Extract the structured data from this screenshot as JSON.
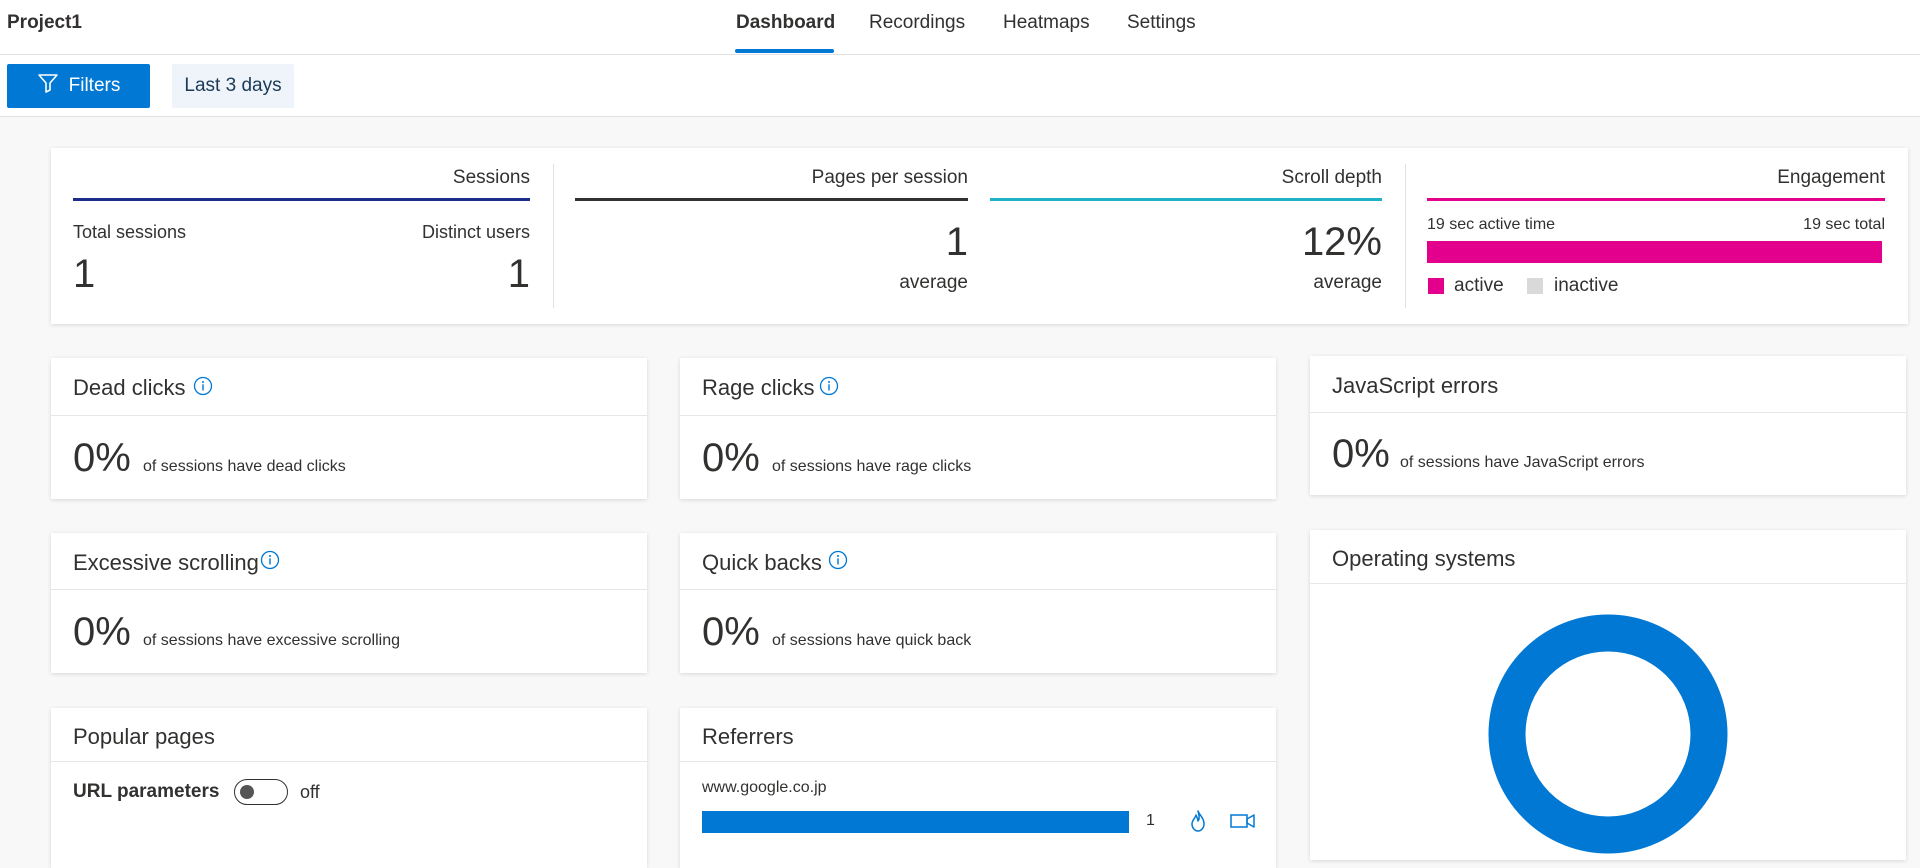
{
  "header": {
    "project": "Project1",
    "tabs": [
      "Dashboard",
      "Recordings",
      "Heatmaps",
      "Settings"
    ],
    "active_tab": "Dashboard"
  },
  "filterbar": {
    "filters_label": "Filters",
    "range_label": "Last 3 days"
  },
  "summary": {
    "sessions": {
      "title": "Sessions",
      "total_label": "Total sessions",
      "total_value": "1",
      "distinct_label": "Distinct users",
      "distinct_value": "1",
      "color": "#1b2e8a"
    },
    "pages": {
      "title": "Pages per session",
      "value": "1",
      "sub": "average",
      "color": "#323130"
    },
    "scroll": {
      "title": "Scroll depth",
      "value": "12%",
      "sub": "average",
      "color": "#1db2c5"
    },
    "engagement": {
      "title": "Engagement",
      "active_label": "19 sec active time",
      "total_label": "19 sec total",
      "active_fraction": 1.0,
      "legend_active": "active",
      "legend_inactive": "inactive",
      "color_active": "#e3008c",
      "color_inactive": "#d9d9d9"
    }
  },
  "cards": {
    "dead_clicks": {
      "title": "Dead clicks",
      "value": "0%",
      "desc": "of sessions have dead clicks"
    },
    "rage_clicks": {
      "title": "Rage clicks",
      "value": "0%",
      "desc": "of sessions have rage clicks"
    },
    "js_errors": {
      "title": "JavaScript errors",
      "value": "0%",
      "desc": "of sessions have JavaScript errors"
    },
    "excessive_scrolling": {
      "title": "Excessive scrolling",
      "value": "0%",
      "desc": "of sessions have excessive scrolling"
    },
    "quick_backs": {
      "title": "Quick backs",
      "value": "0%",
      "desc": "of sessions have quick back"
    },
    "operating_systems": {
      "title": "Operating systems",
      "donut_color": "#0078d4",
      "share": 1.0
    },
    "popular_pages": {
      "title": "Popular pages",
      "url_params_label": "URL parameters",
      "toggle_state": "off"
    },
    "referrers": {
      "title": "Referrers",
      "items": [
        {
          "name": "www.google.co.jp",
          "count": "1",
          "fraction": 1.0
        }
      ]
    }
  },
  "icons": {
    "filter": "filter-icon",
    "info": "info-icon",
    "heatmap": "flame-icon",
    "recording": "video-icon"
  },
  "accent": "#0078d4"
}
